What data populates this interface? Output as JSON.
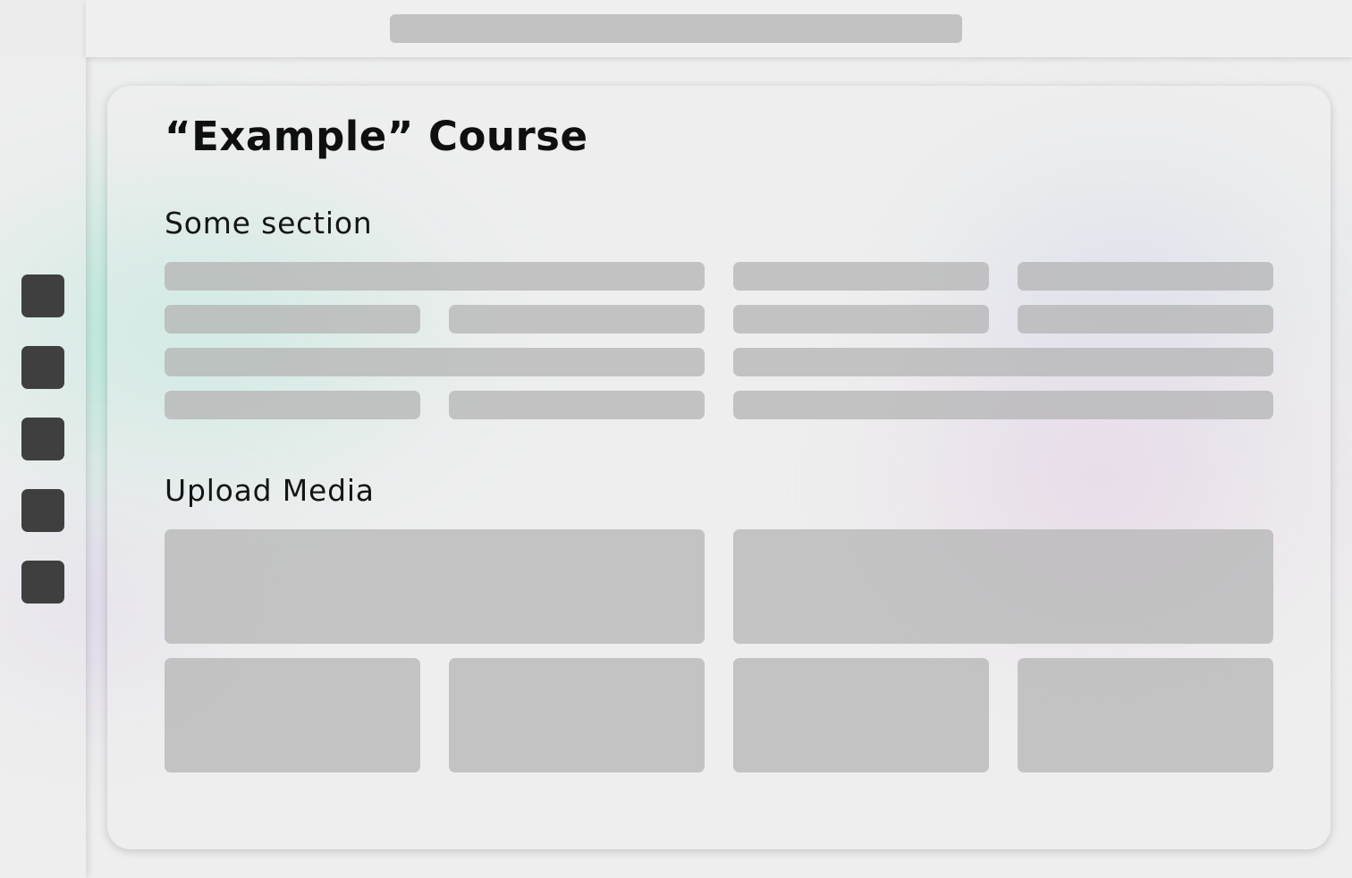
{
  "course": {
    "title": "“Example” Course"
  },
  "sections": {
    "section_one_title": "Some section",
    "upload_media_title": "Upload Media"
  },
  "icons": {
    "nav": [
      "nav-icon-1",
      "nav-icon-2",
      "nav-icon-3",
      "nav-icon-4",
      "nav-icon-5"
    ]
  },
  "colors": {
    "background": "#eeeeee",
    "nav_button": "#3f3f3f",
    "placeholder": "#c2c2c2",
    "text": "#0f0f0f"
  }
}
